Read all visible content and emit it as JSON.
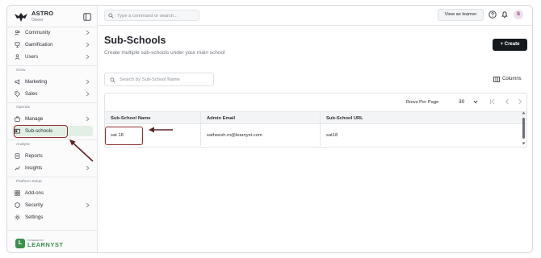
{
  "brand": {
    "name": "ASTRO",
    "role": "Owner"
  },
  "sidebar": {
    "items_top": [
      {
        "label": "Community",
        "icon": "community-icon"
      },
      {
        "label": "Gamification",
        "icon": "gamification-icon"
      },
      {
        "label": "Users",
        "icon": "user-icon"
      }
    ],
    "section_grow": "Grow",
    "items_grow": [
      {
        "label": "Marketing",
        "icon": "megaphone-icon"
      },
      {
        "label": "Sales",
        "icon": "tag-icon"
      }
    ],
    "section_operate": "Operate",
    "items_operate": [
      {
        "label": "Manage",
        "icon": "briefcase-icon"
      },
      {
        "label": "Sub-schools",
        "icon": "school-icon"
      }
    ],
    "section_analyse": "Analyse",
    "items_analyse": [
      {
        "label": "Reports",
        "icon": "report-icon"
      },
      {
        "label": "Insights",
        "icon": "insights-icon"
      }
    ],
    "section_platform": "Platform Setup",
    "items_platform": [
      {
        "label": "Add-ons",
        "icon": "addons-icon"
      },
      {
        "label": "Security",
        "icon": "shield-icon"
      },
      {
        "label": "Settings",
        "icon": "gear-icon"
      }
    ],
    "powered_by": "POWERED BY",
    "logo_text": "LEARNYST"
  },
  "topbar": {
    "command_placeholder": "Type a command or search...",
    "view_as_learner": "View as learner",
    "avatar_initial": "S"
  },
  "main": {
    "title": "Sub-Schools",
    "subtitle": "Create multiple sub-schools under your main school",
    "create_label": "+ Create",
    "search_placeholder": "Search by Sub-School Name",
    "columns_label": "Columns",
    "rows_per_page_label": "Rows Per Page",
    "rows_per_page_value": "30",
    "table": {
      "headers": [
        "Sub-School Name",
        "Admin Email",
        "Sub-School URL"
      ],
      "rows": [
        [
          "sat 18",
          "satheesh.m@learnyst.com",
          "sat18"
        ]
      ]
    }
  },
  "colors": {
    "accent_green": "#3a8f4e",
    "active_bg": "#e2efe4",
    "annotation": "#8b2e2e",
    "create_button": "#151a1e"
  }
}
